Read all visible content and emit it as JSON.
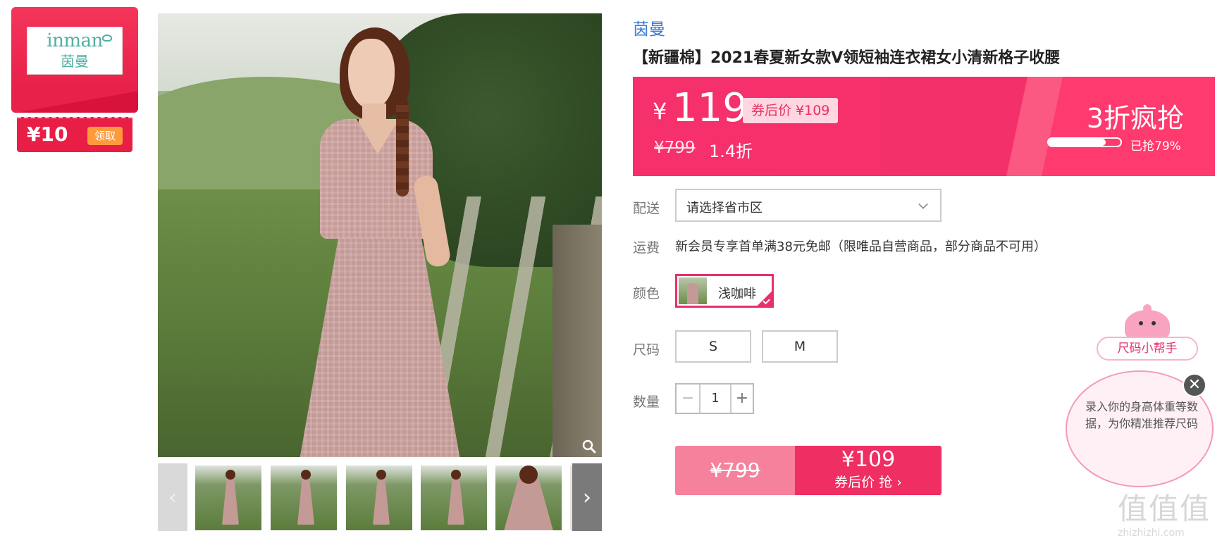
{
  "coupon": {
    "brand_en": "inman",
    "brand_cn": "茵曼",
    "amount": "¥10",
    "claim_label": "领取"
  },
  "product": {
    "brand": "茵曼",
    "title": "【新疆棉】2021春夏新女款V领短袖连衣裙女小清新格子收腰"
  },
  "price": {
    "currency": "¥",
    "current": "119",
    "after_coupon": "券后价 ¥109",
    "original": "¥799",
    "discount": "1.4折",
    "flash_label": "3折疯抢",
    "sold_progress": 0.79,
    "sold_text": "已抢79%"
  },
  "options": {
    "delivery_label": "配送",
    "delivery_placeholder": "请选择省市区",
    "shipping_label": "运费",
    "shipping_text": "新会员专享首单满38元免邮（限唯品自营商品，部分商品不可用）",
    "color_label": "颜色",
    "color_selected": "浅咖啡",
    "size_label": "尺码",
    "sizes": [
      "S",
      "M"
    ],
    "quantity_label": "数量",
    "quantity": "1",
    "minus": "−",
    "plus": "+"
  },
  "buy": {
    "original_price": "¥799",
    "coupon_price": "¥109",
    "coupon_cta": "券后价 抢 ›"
  },
  "size_helper": {
    "title": "尺码小帮手",
    "text": "录入你的身高体重等数据，为你精准推荐尺码",
    "close": "✕"
  },
  "gallery": {
    "prev": "‹",
    "next": "›"
  },
  "watermark": {
    "logo": "值值值",
    "site": "zhizhizhi.com"
  },
  "colors": {
    "accent": "#f3306b",
    "brand_blue": "#3a7bd5",
    "coupon_red": "#e41b44"
  }
}
